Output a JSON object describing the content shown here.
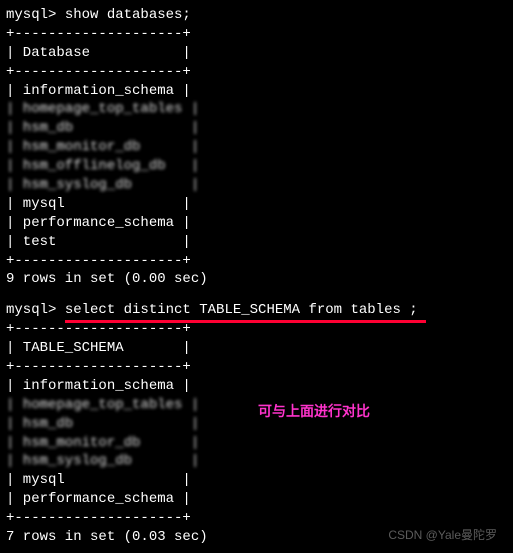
{
  "prompt_prefix": "mysql> ",
  "cmd1": "show databases;",
  "table1": {
    "border": "+--------------------+",
    "header": "| Database           |",
    "rows_raw": [
      "| information_schema |",
      "| mysql              |",
      "| performance_schema |",
      "| test               |"
    ],
    "rows_blur": [
      "| homepage_top_tables |",
      "| hsm_db              |",
      "| hsm_monitor_db      |",
      "| hsm_offlinelog_db   |",
      "| hsm_syslog_db       |"
    ]
  },
  "result1": "9 rows in set (0.00 sec)",
  "cmd2": "select distinct TABLE_SCHEMA from tables ;",
  "table2": {
    "border": "+--------------------+",
    "header": "| TABLE_SCHEMA       |",
    "rows_raw": [
      "| information_schema |",
      "| mysql              |",
      "| performance_schema |"
    ],
    "rows_blur": [
      "| homepage_top_tables |",
      "| hsm_db              |",
      "| hsm_monitor_db      |",
      "| hsm_syslog_db       |"
    ]
  },
  "result2": "7 rows in set (0.03 sec)",
  "annotation": "可与上面进行对比",
  "watermark": "CSDN @Yale曼陀罗"
}
